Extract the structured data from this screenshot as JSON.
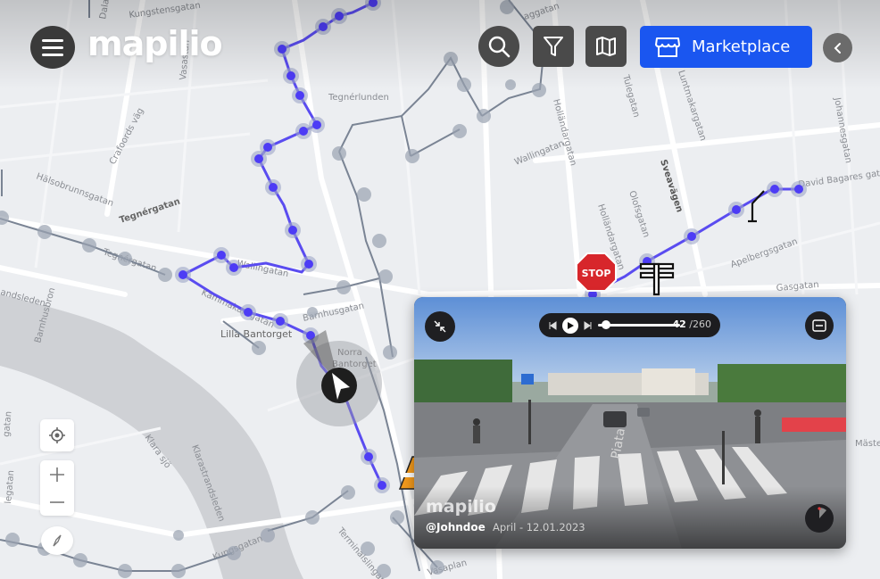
{
  "app": {
    "logo_text": "mapilio"
  },
  "header": {
    "menu_icon": "hamburger-menu-icon",
    "search_icon": "search-icon",
    "filter_icon": "filter-icon",
    "layers_icon": "map-layers-icon",
    "marketplace_label": "Marketplace",
    "marketplace_icon": "storefront-icon",
    "collapse_icon": "chevron-left-icon",
    "accent_color": "#1a56f0"
  },
  "map": {
    "street_labels": [
      "Dalagatan",
      "Kungstensgatan",
      "Vasastan",
      "Tegnérlunden",
      "Holländargatan",
      "Tulegatan",
      "Luntmakargatan",
      "Johannesgatan",
      "Crafoords väg",
      "Wallingatan",
      "Sveavägen",
      "Hälsobrunnsgatan",
      "Tegnérgatan",
      "Olofsgatan",
      "David Bagares gatan",
      "Tegnérgatan",
      "Holländargatan",
      "Apelbergsgatan",
      "andsleden",
      "Barnhusbron",
      "Wallingatan",
      "Kammakaregatan",
      "Barnhusgatan",
      "Lilla Bantorget",
      "Norra Bantorget",
      "Klarastrandsleden",
      "Klara sjö",
      "Kungsgatan",
      "Terminalslingan",
      "Vasaplan",
      "gatan",
      "legatan",
      "Mäste",
      "Gasgatan",
      "aggatan"
    ],
    "signs": [
      "stop-sign-icon",
      "road-cone-icon",
      "utility-pole-icon",
      "street-lamp-icon"
    ],
    "controls": {
      "locate_icon": "locate-icon",
      "zoom_in_icon": "plus-icon",
      "zoom_out_icon": "minus-icon",
      "compass_icon": "compass-icon"
    }
  },
  "viewer": {
    "frame_current": "42",
    "frame_total": "/260",
    "progress": 0.08,
    "watermark": "mapilio",
    "author": "@Johndoe",
    "capture_date": "April - 12.01.2023",
    "scene_sign": "STOP"
  }
}
